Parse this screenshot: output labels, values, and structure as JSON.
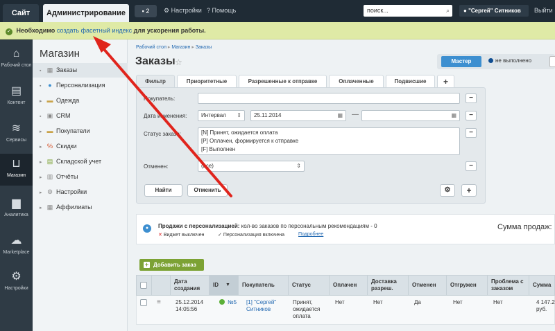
{
  "topbar": {
    "site_tab": "Сайт",
    "admin_tab": "Администрирование",
    "notifications": "2",
    "settings": "Настройки",
    "help": "Помощь",
    "search_value": "поиск...",
    "user": "\"Сергей\" Ситников",
    "logout": "Выйти"
  },
  "notice": {
    "prefix": "Необходимо",
    "link": "создать фасетный индекс",
    "suffix": "для ускорения работы."
  },
  "left_bar": [
    {
      "label": "Рабочий стол",
      "icon": "home-icon"
    },
    {
      "label": "Контент",
      "icon": "document-icon"
    },
    {
      "label": "Сервисы",
      "icon": "layers-icon"
    },
    {
      "label": "Магазин",
      "icon": "basket-icon"
    },
    {
      "label": "Аналитика",
      "icon": "bar-chart-icon"
    },
    {
      "label": "Marketplace",
      "icon": "cloud-download-icon"
    },
    {
      "label": "Настройки",
      "icon": "gear-icon"
    }
  ],
  "menu": {
    "title": "Магазин",
    "items": [
      {
        "label": "Заказы",
        "icon": "orders-icon"
      },
      {
        "label": "Персонализация",
        "icon": "person-icon"
      },
      {
        "label": "Одежда",
        "icon": "folder-icon"
      },
      {
        "label": "CRM",
        "icon": "crm-icon"
      },
      {
        "label": "Покупатели",
        "icon": "folder-icon"
      },
      {
        "label": "Скидки",
        "icon": "discount-icon"
      },
      {
        "label": "Складской учет",
        "icon": "warehouse-icon"
      },
      {
        "label": "Отчёты",
        "icon": "reports-icon"
      },
      {
        "label": "Настройки",
        "icon": "settings-icon"
      },
      {
        "label": "Аффилиаты",
        "icon": "affiliates-icon"
      }
    ]
  },
  "breadcrumb": [
    "Рабочий стол",
    "Магазин",
    "Заказы"
  ],
  "page_title": "Заказы",
  "master": {
    "button": "Мастер",
    "status": "не выполнено"
  },
  "filter": {
    "tabs": [
      "Фильтр",
      "Приоритетные",
      "Разрешенные к отправке",
      "Оплаченные",
      "Подвисшие"
    ],
    "add_tab": "+",
    "buyer_label": "Покупатель:",
    "buyer_value": "",
    "date_label": "Дата изменения:",
    "date_mode": "Интервал",
    "date_from": "25.11.2014",
    "date_to": "",
    "status_label": "Статус заказа:",
    "status_options": [
      "[N] Принят, ожидается оплата",
      "[P] Оплачен, формируется к отправке",
      "[F] Выполнен"
    ],
    "canceled_label": "Отменен:",
    "canceled_value": "(все)",
    "find_button": "Найти",
    "cancel_button": "Отменить"
  },
  "personalization": {
    "title": "Продажи с персонализацией:",
    "text": "кол-во заказов по персональным рекомендациям - 0",
    "widget_off": "Виджет выключен",
    "personalization_on": "Персонализация включена",
    "more": "Подробнее",
    "sales_label": "Сумма продаж:"
  },
  "grid": {
    "add_button": "Добавить заказ",
    "headers": [
      "Дата создания",
      "ID",
      "Покупатель",
      "Статус",
      "Оплачен",
      "Доставка разреш.",
      "Отменен",
      "Отгружен",
      "Проблема с заказом",
      "Сумма"
    ],
    "row": {
      "date": "25.12.2014 14:05:56",
      "id": "№5",
      "buyer": "[1] \"Сергей\" Ситников",
      "status": "Принят, ожидается оплата",
      "paid": "Нет",
      "delivery": "Нет",
      "canceled": "Да",
      "shipped": "Нет",
      "problem": "Нет",
      "sum": "4 147.2 руб."
    }
  },
  "colors": {
    "accent": "#3d8fd0",
    "add_button": "#7ca234",
    "arrow": "#e0241c",
    "notice_bg": "#dfeaa6"
  }
}
